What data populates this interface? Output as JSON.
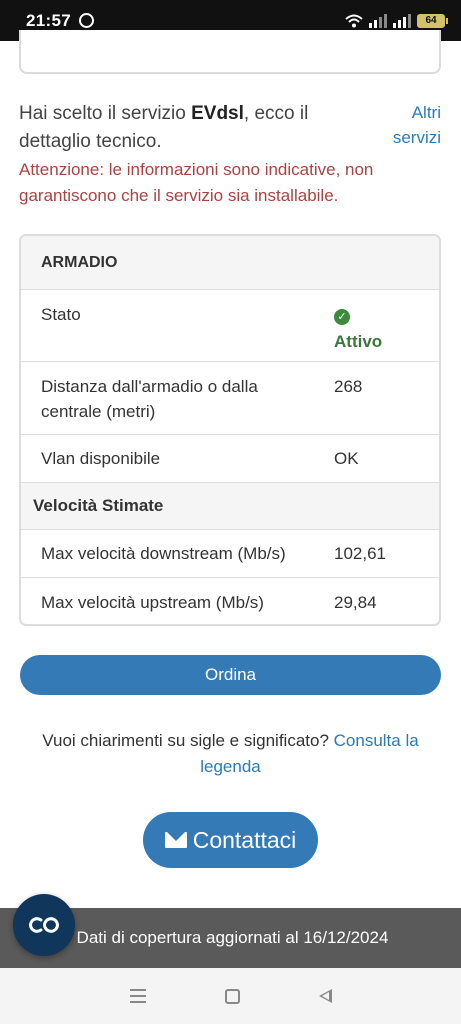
{
  "status_bar": {
    "time": "21:57",
    "battery": "64"
  },
  "intro": {
    "prefix": "Hai scelto il servizio ",
    "service": "EVdsl",
    "suffix": ", ecco il dettaglio tecnico.",
    "other_services_link": "Altri servizi",
    "warning": "Attenzione: le informazioni sono indicative, non garantiscono che il servizio sia installabile."
  },
  "panel": {
    "title": "ARMADIO",
    "rows": [
      {
        "label": "Stato",
        "value": "Attivo"
      },
      {
        "label": "Distanza dall'armadio o dalla centrale (metri)",
        "value": "268"
      },
      {
        "label": "Vlan disponibile",
        "value": "OK"
      }
    ],
    "speed_section_title": "Velocità Stimate",
    "speed_rows": [
      {
        "label": "Max velocità downstream (Mb/s)",
        "value": "102,61"
      },
      {
        "label": "Max velocità upstream (Mb/s)",
        "value": "29,84"
      }
    ]
  },
  "order_button": "Ordina",
  "help": {
    "text": "Vuoi chiarimenti su sigle e significato? ",
    "link": "Consulta la legenda"
  },
  "contact_button": "Contattaci",
  "banner": "Dati di copertura aggiornati al 16/12/2024",
  "colors": {
    "primary": "#337ab7",
    "warning": "#a94442",
    "success": "#3c763d",
    "fab": "#10365c"
  }
}
